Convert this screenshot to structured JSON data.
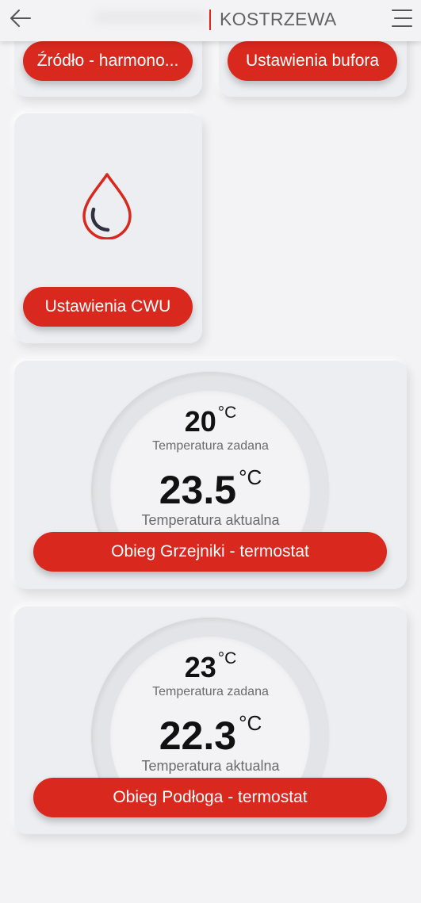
{
  "header": {
    "title": "KOSTRZEWA",
    "back_icon": "arrow-left-icon",
    "menu_icon": "hamburger-menu-icon"
  },
  "colors": {
    "accent": "#d9281e",
    "drop_dark": "#2f3142",
    "card_bg": "#eceef1",
    "page_bg": "#f3f3f6"
  },
  "cards": {
    "source": {
      "button_label": "Źródło - harmono..."
    },
    "buffer": {
      "button_label": "Ustawienia bufora"
    },
    "dhw": {
      "icon": "water-drop-icon",
      "button_label": "Ustawienia CWU"
    }
  },
  "thermostats": [
    {
      "set_value": "20",
      "set_unit": "°C",
      "set_caption": "Temperatura zadana",
      "current_value": "23.5",
      "current_unit": "°C",
      "current_caption": "Temperatura aktualna",
      "button_label": "Obieg Grzejniki - termostat"
    },
    {
      "set_value": "23",
      "set_unit": "°C",
      "set_caption": "Temperatura zadana",
      "current_value": "22.3",
      "current_unit": "°C",
      "current_caption": "Temperatura aktualna",
      "button_label": "Obieg Podłoga - termostat"
    }
  ]
}
